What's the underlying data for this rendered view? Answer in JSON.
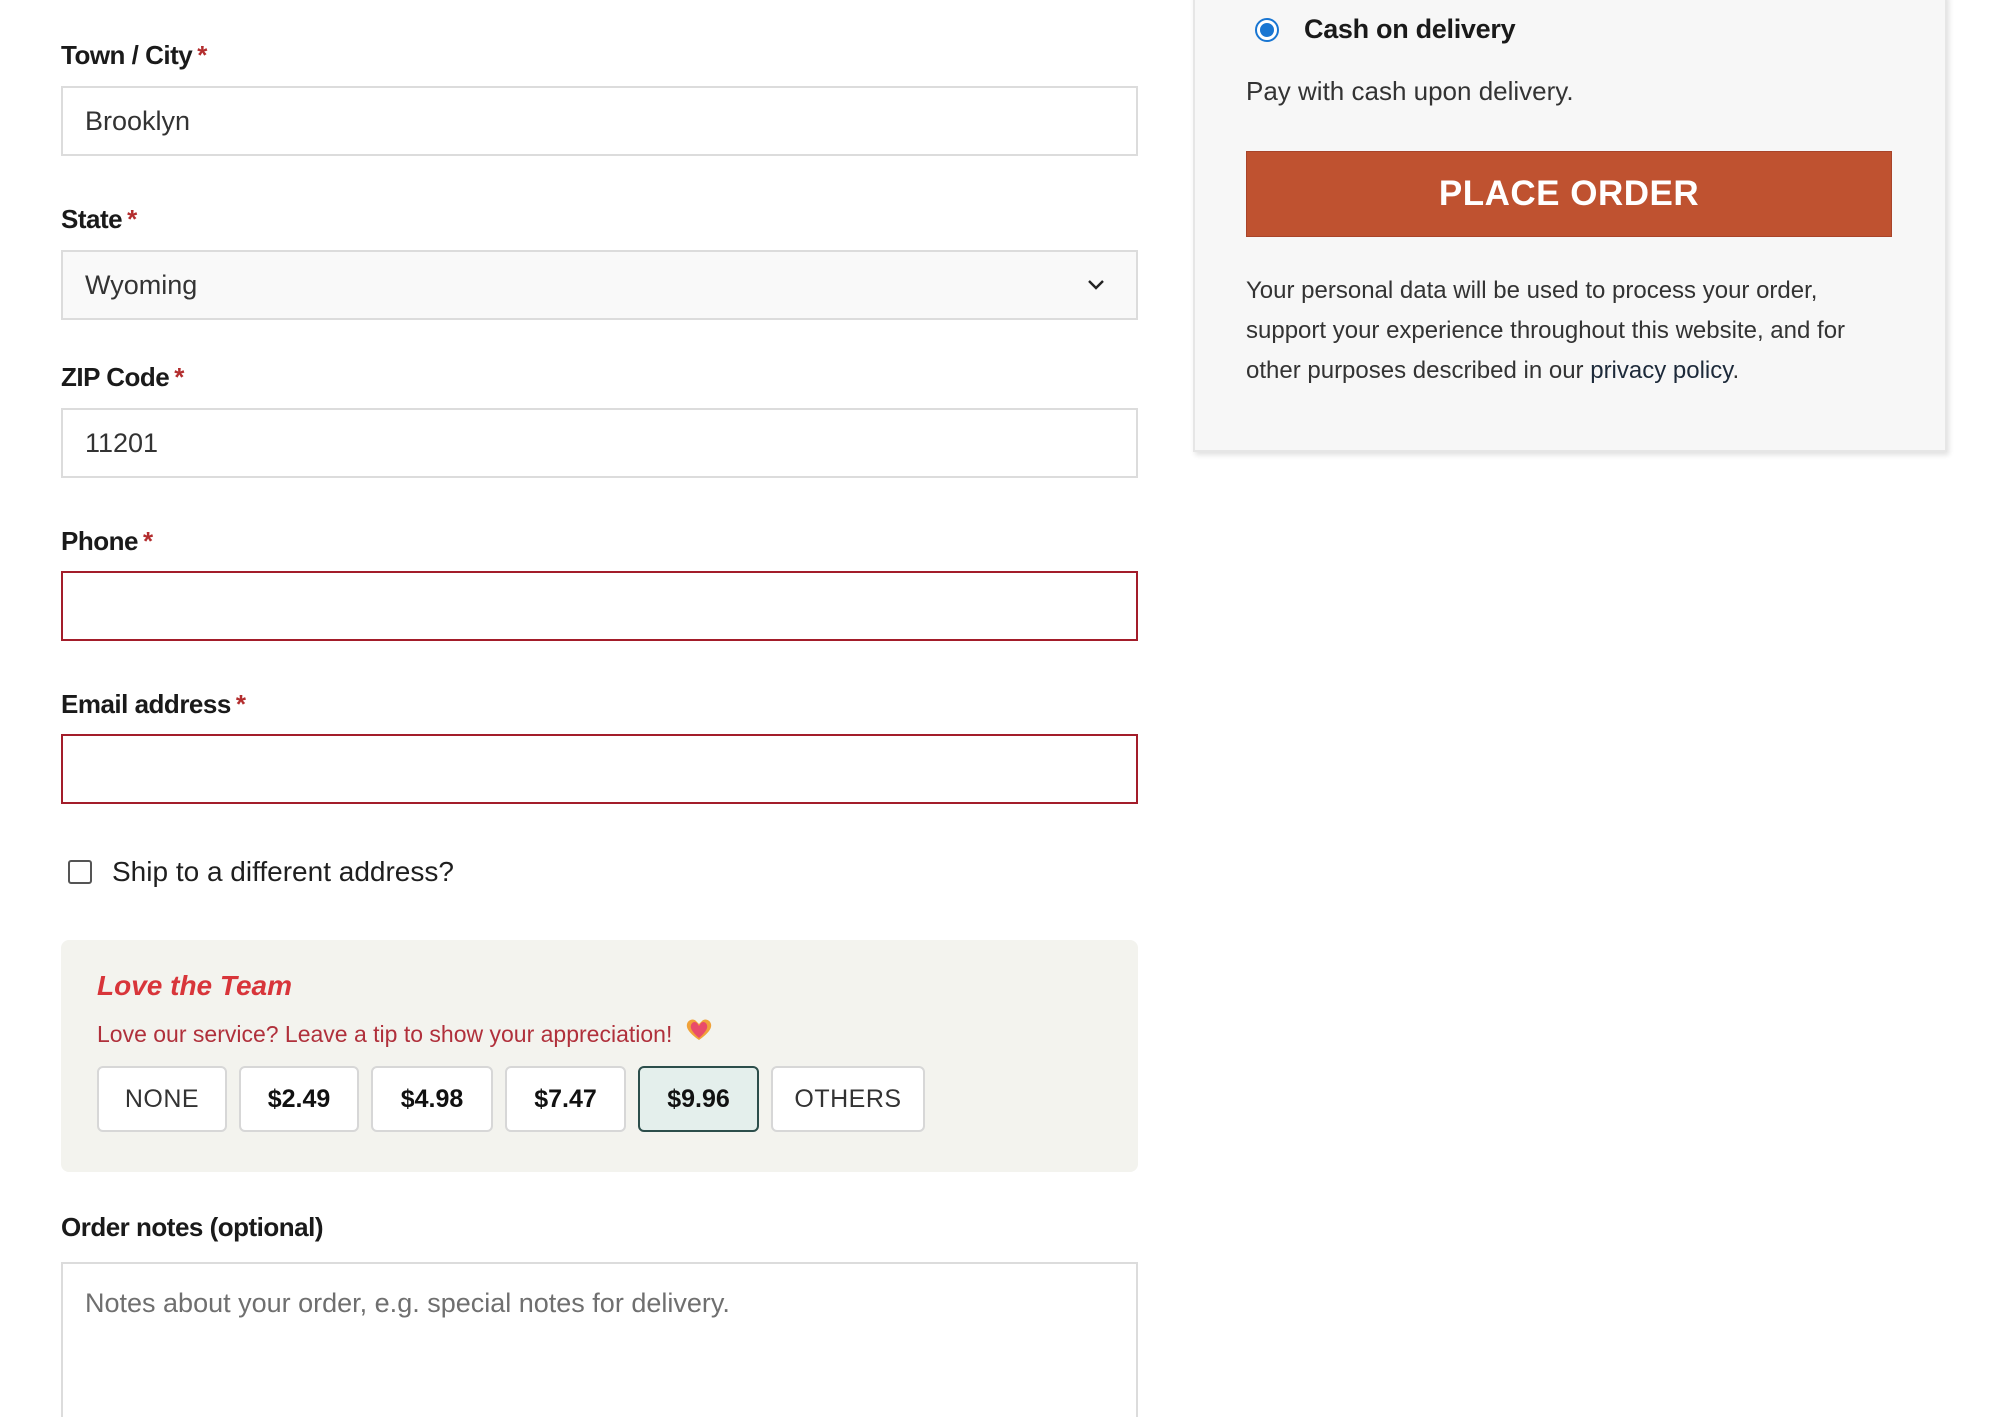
{
  "billing": {
    "town": {
      "label": "Town / City",
      "required_mark": "*",
      "value": "Brooklyn"
    },
    "state": {
      "label": "State",
      "required_mark": "*",
      "value": "Wyoming"
    },
    "zip": {
      "label": "ZIP Code",
      "required_mark": "*",
      "value": "11201"
    },
    "phone": {
      "label": "Phone",
      "required_mark": "*",
      "value": ""
    },
    "email": {
      "label": "Email address",
      "required_mark": "*",
      "value": ""
    }
  },
  "ship_different": {
    "label": "Ship to a different address?",
    "checked": false
  },
  "tip": {
    "title": "Love the Team",
    "subtitle": "Love our service? Leave a tip to show your appreciation!",
    "heart_icon": "heart-icon",
    "options": [
      "NONE",
      "$2.49",
      "$4.98",
      "$7.47",
      "$9.96",
      "OTHERS"
    ],
    "selected": "$9.96"
  },
  "notes": {
    "label": "Order notes (optional)",
    "placeholder": "Notes about your order, e.g. special notes for delivery."
  },
  "payment": {
    "method_label": "Cash on delivery",
    "method_description": "Pay with cash upon delivery.",
    "place_order_label": "PLACE ORDER",
    "privacy_text": "Your personal data will be used to process your order, support your experience throughout this website, and for other purposes described in our",
    "privacy_link": "privacy policy",
    "privacy_end": "."
  },
  "colors": {
    "accent_button": "#bf5230",
    "error_border": "#a31d2a",
    "required": "#b32d2e",
    "tip_title": "#d8353a",
    "radio": "#1976d2"
  }
}
